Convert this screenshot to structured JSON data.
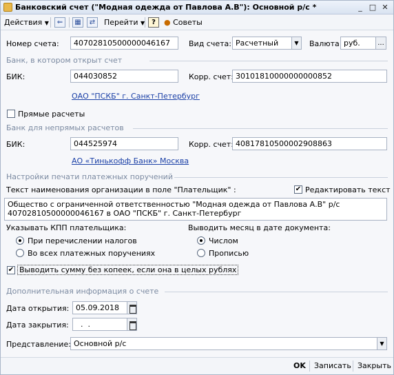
{
  "window": {
    "title": "Банковский счет (\"Модная одежда от Павлова А.В\"): Основной р/с *",
    "minimize": "_",
    "restore": "□",
    "close": "✕"
  },
  "toolbar": {
    "actions_label": "Действия",
    "goto_label": "Перейти",
    "help_label": "?",
    "tips_label": "Советы"
  },
  "account": {
    "number_label": "Номер счета:",
    "number_value": "40702810500000046167",
    "type_label": "Вид счета:",
    "type_value": "Расчетный",
    "currency_label": "Валюта:",
    "currency_value": "руб.",
    "currency_btn": "..."
  },
  "bank": {
    "section": "Банк, в котором открыт счет",
    "bik_label": "БИК:",
    "bik_value": "044030852",
    "corr_label": "Корр. счет:",
    "corr_value": "30101810000000000852",
    "bank_name": "ОАО \"ПСКБ\" г. Санкт-Петербург",
    "direct_label": "Прямые расчеты"
  },
  "indirect_bank": {
    "section": "Банк для непрямых расчетов",
    "bik_label": "БИК:",
    "bik_value": "044525974",
    "corr_label": "Корр. счет:",
    "corr_value": "40817810500002908863",
    "bank_name": "АО «Тинькофф Банк» Москва"
  },
  "print": {
    "section": "Настройки печати платежных поручений",
    "payer_text_label": "Текст наименования организации в поле \"Плательщик\" :",
    "edit_text_label": "Редактировать текст",
    "payer_text_line1": "Общество с ограниченной ответственностью \"Модная одежда от Павлова А.В\" р/с",
    "payer_text_line2": "40702810500000046167 в ОАО \"ПСКБ\" г. Санкт-Петербург",
    "kpp_label": "Указывать КПП плательщика:",
    "kpp_opt1": "При перечислении налогов",
    "kpp_opt2": "Во всех платежных поручениях",
    "month_label": "Выводить месяц в дате документа:",
    "month_opt1": "Числом",
    "month_opt2": "Прописью",
    "no_kopecks_label": "Выводить сумму без копеек, если она в целых рублях"
  },
  "extra": {
    "section": "Дополнительная информация о счете",
    "open_date_label": "Дата открытия:",
    "open_date_value": "05.09.2018",
    "close_date_label": "Дата закрытия:",
    "close_date_value": "  .  .",
    "repr_label": "Представление:",
    "repr_value": "Основной р/с"
  },
  "footer": {
    "ok": "OK",
    "save": "Записать",
    "close": "Закрыть"
  }
}
